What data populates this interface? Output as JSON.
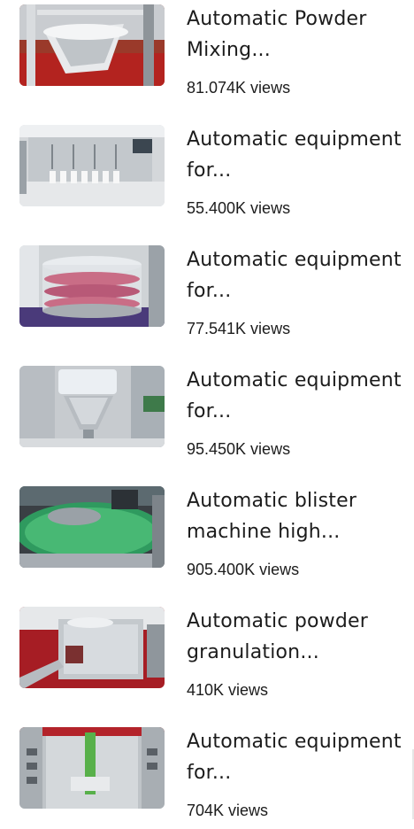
{
  "videos": [
    {
      "title": "Automatic Powder Mixing...",
      "views": "81.074K views",
      "thumb_icon": "powder-mixer-thumbnail"
    },
    {
      "title": "Automatic equipment for...",
      "views": "55.400K views",
      "thumb_icon": "bottle-filling-thumbnail"
    },
    {
      "title": "Automatic equipment for...",
      "views": "77.541K views",
      "thumb_icon": "capsule-drum-thumbnail"
    },
    {
      "title": "Automatic equipment for...",
      "views": "95.450K views",
      "thumb_icon": "funnel-hopper-thumbnail"
    },
    {
      "title": "Automatic blister machine high...",
      "views": "905.400K views",
      "thumb_icon": "green-tablets-thumbnail"
    },
    {
      "title": "Automatic powder granulation...",
      "views": "410K views",
      "thumb_icon": "granulator-thumbnail"
    },
    {
      "title": "Automatic equipment for...",
      "views": "704K views",
      "thumb_icon": "packing-machine-thumbnail"
    }
  ],
  "colors": {
    "text": "#1c1c1c",
    "background": "#ffffff",
    "steel": "#b9bec4",
    "red_floor": "#a61d24",
    "green_tablets": "#3fae6a"
  }
}
